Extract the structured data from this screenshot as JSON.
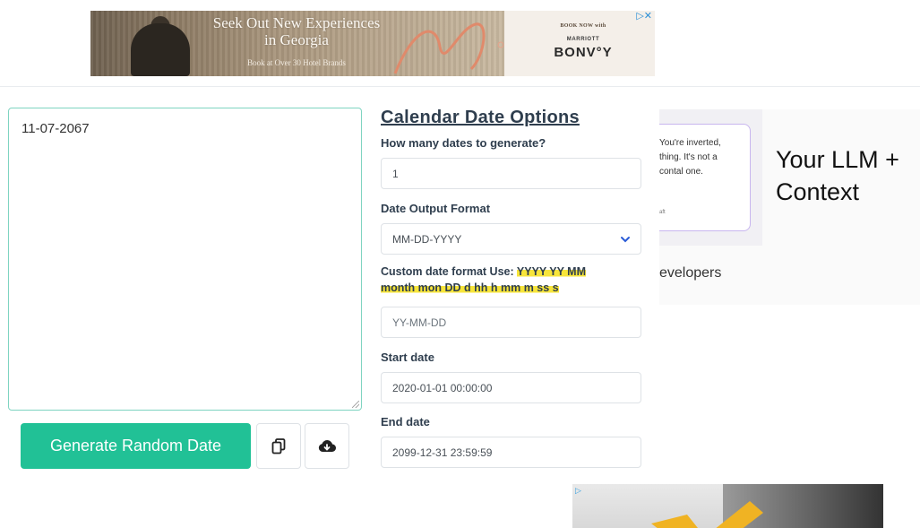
{
  "top_ad": {
    "headline_1": "Seek Out New Experiences",
    "headline_2": "in Georgia",
    "subline": "Book at Over 30 Hotel Brands",
    "book_now": "BOOK NOW with",
    "marriott": "MARRIOTT",
    "bonvoy": "BONV°Y",
    "adchoices": "▷✕"
  },
  "output": {
    "value": "11-07-2067"
  },
  "actions": {
    "generate_label": "Generate Random Date",
    "copy_icon": "copy-icon",
    "download_icon": "cloud-download-icon"
  },
  "options": {
    "title": "Calendar Date Options",
    "count_label": "How many dates to generate?",
    "count_value": "1",
    "format_label": "Date Output Format",
    "format_value": "MM-DD-YYYY",
    "custom_label_prefix": "Custom date format Use: ",
    "custom_label_tokens_1": "YYYY YY MM",
    "custom_label_tokens_2": "month mon DD d hh h mm m ss s",
    "custom_placeholder": "YY-MM-DD",
    "start_label": "Start date",
    "start_value": "2020-01-01 00:00:00",
    "end_label": "End date",
    "end_value": "2099-12-31 23:59:59"
  },
  "right_ad": {
    "card_text_1": "You're inverted,",
    "card_text_2": "thing. It's not a",
    "card_text_3": "contal one.",
    "card_foot": "aft",
    "headline_1": "Your LLM +",
    "headline_2": "Context",
    "sub": "evelopers"
  },
  "bottom_ad": {
    "mark": "▷"
  },
  "colors": {
    "accent": "#21c196",
    "textarea_border": "#7fd4c1",
    "highlight": "#f7e53a",
    "heading": "#2f3e4e"
  }
}
